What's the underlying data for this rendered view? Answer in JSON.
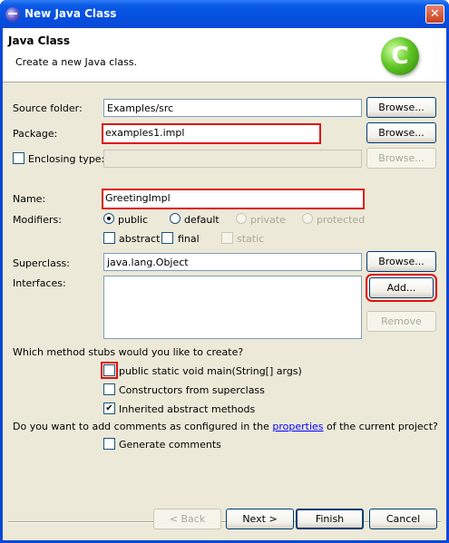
{
  "window": {
    "title": "New Java Class",
    "close_glyph": "✕"
  },
  "banner": {
    "title": "Java Class",
    "description": "Create a new Java class.",
    "logo_glyph": "C"
  },
  "source_folder": {
    "label": "Source folder:",
    "value": "Examples/src",
    "browse": "Browse..."
  },
  "package": {
    "label": "Package:",
    "value": "examples1.impl",
    "browse": "Browse..."
  },
  "enclosing_type": {
    "label": "Enclosing type:",
    "value": "",
    "browse": "Browse..."
  },
  "name": {
    "label": "Name:",
    "value": "GreetingImpl"
  },
  "modifiers": {
    "label": "Modifiers:",
    "options": [
      "public",
      "default",
      "private",
      "protected"
    ],
    "selected": "public",
    "abstract": "abstract",
    "final": "final",
    "static": "static"
  },
  "superclass": {
    "label": "Superclass:",
    "value": "java.lang.Object",
    "browse": "Browse..."
  },
  "interfaces": {
    "label": "Interfaces:",
    "add": "Add...",
    "remove": "Remove"
  },
  "stubs": {
    "question": "Which method stubs would you like to create?",
    "main": "public static void main(String[] args)",
    "constructors": "Constructors from superclass",
    "inherited": "Inherited abstract methods",
    "inherited_checked": true
  },
  "comments": {
    "question_before": "Do you want to add comments as configured in the ",
    "question_link": "properties",
    "question_after": " of the current project?",
    "generate": "Generate comments"
  },
  "footer": {
    "back": "< Back",
    "next": "Next >",
    "finish": "Finish",
    "cancel": "Cancel"
  },
  "icons": {
    "checkmark": "✔"
  },
  "colors": {
    "highlight": "#e01010",
    "titlebar": "#0a5ae6",
    "dialog_bg": "#ece9d8"
  }
}
